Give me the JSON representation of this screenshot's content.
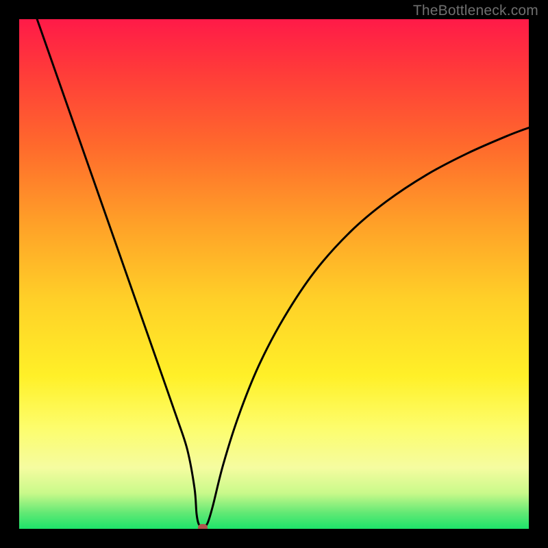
{
  "watermark": "TheBottleneck.com",
  "colors": {
    "frame": "#000000",
    "curve_stroke": "#000000",
    "marker": "#b0544d",
    "gradient_top": "#ff1a48",
    "gradient_bottom": "#1de46a"
  },
  "chart_data": {
    "type": "line",
    "title": "",
    "xlabel": "",
    "ylabel": "",
    "xlim": [
      0,
      100
    ],
    "ylim": [
      0,
      100
    ],
    "grid": false,
    "legend": false,
    "series": [
      {
        "name": "bottleneck-curve",
        "x": [
          0,
          4,
          8,
          12,
          16,
          20,
          24,
          28,
          31,
          33,
          34.4,
          34.8,
          35.2,
          35.8,
          36.3,
          37,
          38,
          40,
          43,
          47,
          52,
          58,
          65,
          72,
          80,
          88,
          96,
          100
        ],
        "values": [
          110,
          98.6,
          87.2,
          75.8,
          64.4,
          53.0,
          41.6,
          30.2,
          21.6,
          15.5,
          8.0,
          3.0,
          1.0,
          0.4,
          0.4,
          1.2,
          4.5,
          12.5,
          22.0,
          32.0,
          41.5,
          50.5,
          58.3,
          64.2,
          69.5,
          73.7,
          77.2,
          78.7
        ]
      }
    ],
    "marker": {
      "x": 36.0,
      "y": 0.3
    }
  }
}
